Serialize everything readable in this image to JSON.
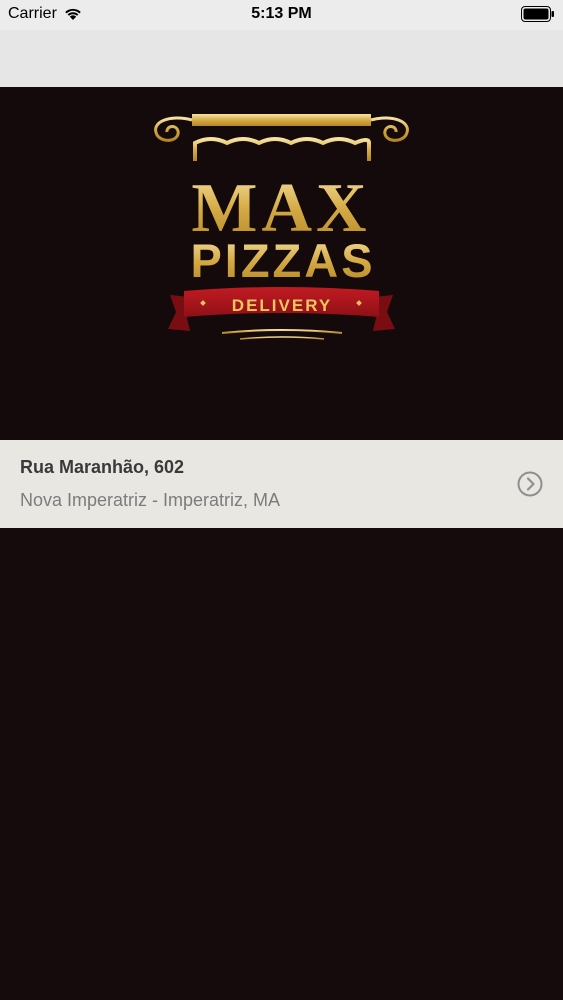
{
  "status_bar": {
    "carrier": "Carrier",
    "time": "5:13 PM",
    "wifi_icon": "wifi-icon",
    "battery_icon": "battery-icon"
  },
  "logo": {
    "line1": "MAX",
    "line2": "PIZZAS",
    "ribbon": "DELIVERY"
  },
  "address": {
    "street": "Rua Maranhão, 602",
    "city": "Nova Imperatriz - Imperatriz, MA",
    "action_icon": "chevron-right-circle-icon"
  },
  "colors": {
    "background": "#150b0c",
    "gold": "#d4a838",
    "ribbon_red": "#a8151d",
    "card": "#e9e7e2"
  }
}
